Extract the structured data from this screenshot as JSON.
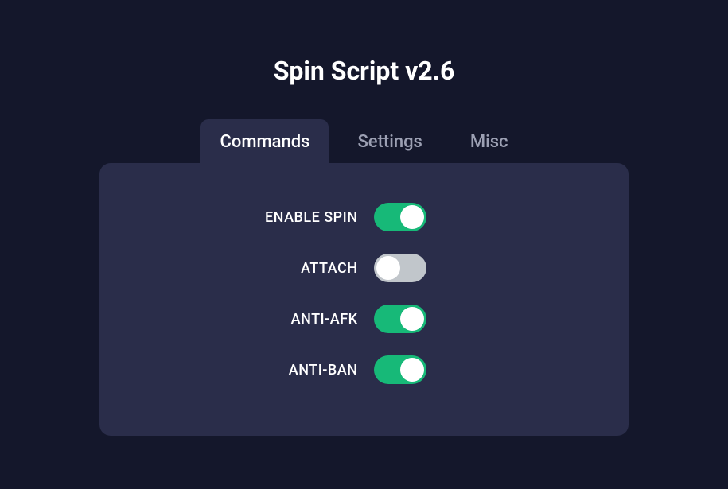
{
  "title": "Spin Script v2.6",
  "tabs": [
    {
      "label": "Commands",
      "active": true
    },
    {
      "label": "Settings",
      "active": false
    },
    {
      "label": "Misc",
      "active": false
    }
  ],
  "commands": [
    {
      "label": "ENABLE SPIN",
      "on": true
    },
    {
      "label": "ATTACH",
      "on": false
    },
    {
      "label": "ANTI-AFK",
      "on": true
    },
    {
      "label": "ANTI-BAN",
      "on": true
    }
  ],
  "colors": {
    "background": "#14172b",
    "panel": "#2a2d4a",
    "accent_on": "#17b978",
    "accent_off": "#c1c6cb",
    "text": "#ffffff",
    "text_muted": "#9ca0b3"
  }
}
